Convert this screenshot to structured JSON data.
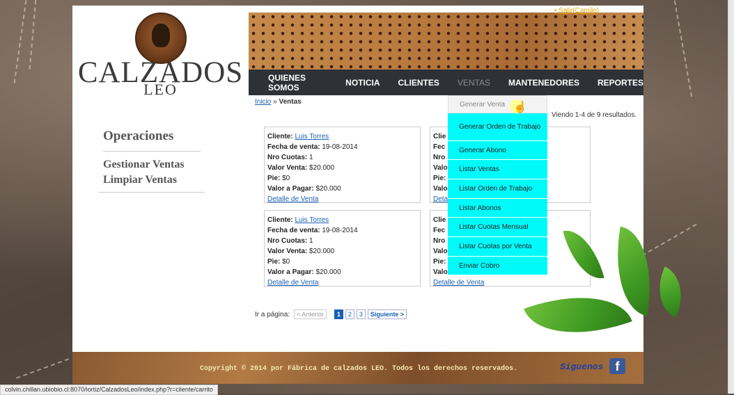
{
  "header": {
    "logout_label": "Salir(Camilo)",
    "logo_title": "CALZADOS",
    "logo_sub": "LEO"
  },
  "nav": {
    "items": [
      "QUIENES SOMOS",
      "NOTICIA",
      "CLIENTES",
      "VENTAS",
      "MANTENEDORES",
      "REPORTES"
    ]
  },
  "breadcrumb": {
    "home": "Inicio",
    "separator": "»",
    "current": "Ventas"
  },
  "results_text": "Viendo 1-4 de 9 resultados.",
  "sidebar": {
    "title": "Operaciones",
    "links": [
      "Gestionar Ventas",
      "Limpiar Ventas"
    ]
  },
  "cards": [
    {
      "cliente_label": "Cliente:",
      "cliente": "Luis Torres",
      "fecha_label": "Fecha de venta:",
      "fecha": "19-08-2014",
      "cuotas_label": "Nro Cuotas:",
      "cuotas": "1",
      "valor_label": "Valor Venta:",
      "valor": "$20.000",
      "pie_label": "Pie:",
      "pie": "$0",
      "pagar_label": "Valor a Pagar:",
      "pagar": "$20.000",
      "detalle": "Detalle de Venta"
    },
    {
      "cliente_label": "Clie",
      "fecha_label": "Fec",
      "cuotas_label": "Nro",
      "valor_label": "Valo",
      "pie_label": "Pie:",
      "pagar_label": "Valo",
      "detalle": "Deta"
    },
    {
      "cliente_label": "Cliente:",
      "cliente": "Luis Torres",
      "fecha_label": "Fecha de venta:",
      "fecha": "19-08-2014",
      "cuotas_label": "Nro Cuotas:",
      "cuotas": "1",
      "valor_label": "Valor Venta:",
      "valor": "$20.000",
      "pie_label": "Pie:",
      "pie": "$0",
      "pagar_label": "Valor a Pagar:",
      "pagar": "$20.000",
      "detalle": "Detalle de Venta"
    },
    {
      "cliente_label": "Clie",
      "fecha_label": "Fec",
      "cuotas_label": "Nro",
      "valor_label": "Valo",
      "pie_label": "Pie:",
      "pagar_label": "Valo",
      "detalle": "Detalle de Venta"
    }
  ],
  "pager": {
    "label": "Ir a página:",
    "prev": "< Anterior",
    "pages": [
      "1",
      "2",
      "3"
    ],
    "next": "Siguiente >"
  },
  "dropdown": {
    "header": "Generar Venta",
    "items": [
      "Generar Orden de Trabajo",
      "Generar Abono",
      "Listar Ventas",
      "Listar Orden de Trabajo",
      "Listar Abonos",
      "Listar Cuotas Mensual",
      "Listar Cuotas por Venta",
      "Enviar Cobro"
    ]
  },
  "footer": {
    "copyright": "Copyright © 2014 por Fábrica de calzados LEO. Todos los derechos reservados.",
    "follow": "Siguenos en:",
    "fb": "f"
  },
  "status_bar": "colvin.chillan.ubiobio.cl:8070/iortiz/CalzadosLeo/index.php?r=cliente/carrito",
  "colors": {
    "menu_highlight": "#00fafa",
    "nav_bg": "#2e3136",
    "link": "#1a5fb4"
  }
}
